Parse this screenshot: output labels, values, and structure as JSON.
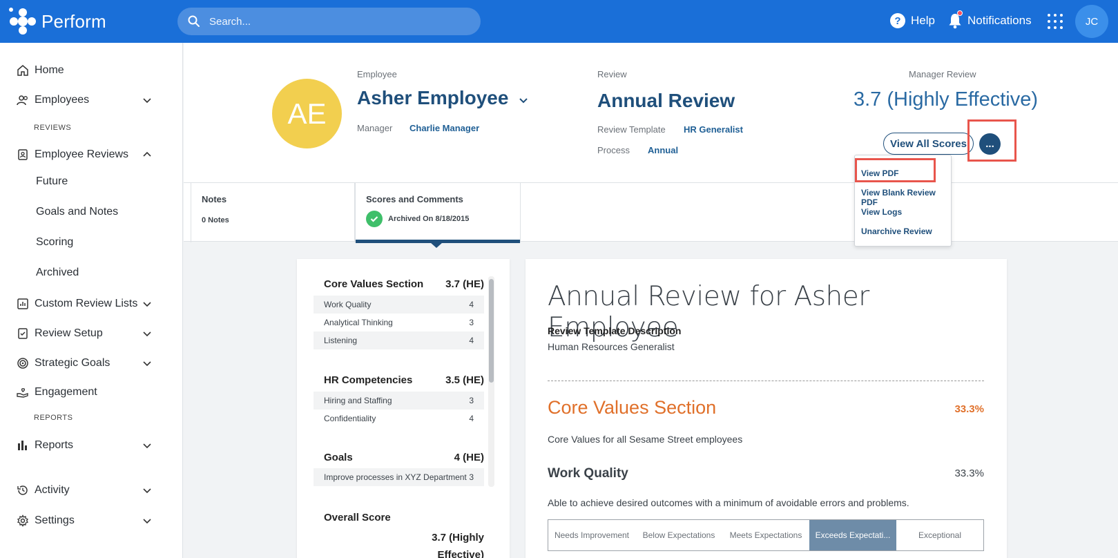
{
  "app": {
    "name": "Perform"
  },
  "search": {
    "placeholder": "Search..."
  },
  "topbar": {
    "help": "Help",
    "notifications": "Notifications",
    "user_initials": "JC"
  },
  "sidebar": {
    "home": "Home",
    "employees": "Employees",
    "reviews_section": "REVIEWS",
    "employee_reviews": "Employee Reviews",
    "sub_items": [
      "Future",
      "Goals and Notes",
      "Scoring",
      "Archived"
    ],
    "custom_review_lists": "Custom Review Lists",
    "review_setup": "Review Setup",
    "strategic_goals": "Strategic Goals",
    "engagement": "Engagement",
    "reports_section": "REPORTS",
    "reports": "Reports",
    "activity": "Activity",
    "settings": "Settings"
  },
  "header": {
    "avatar_initials": "AE",
    "employee_label": "Employee",
    "employee_name": "Asher Employee",
    "manager_label": "Manager",
    "manager_name": "Charlie Manager",
    "review_label": "Review",
    "review_name": "Annual Review",
    "template_label": "Review Template",
    "template_name": "HR Generalist",
    "process_label": "Process",
    "process_name": "Annual",
    "manager_review_label": "Manager Review",
    "manager_review_score": "3.7 (Highly Effective)",
    "view_all_scores": "View All Scores",
    "more_label": "..."
  },
  "menu": {
    "items": [
      "View PDF",
      "View Blank Review PDF",
      "View Logs",
      "Unarchive Review"
    ]
  },
  "tabs": [
    {
      "title": "Notes",
      "sub": "0 Notes"
    },
    {
      "title": "Scores and Comments",
      "sub": "Archived On 8/18/2015"
    }
  ],
  "score_panel": {
    "sections": [
      {
        "name": "Core Values Section",
        "score": "3.7 (HE)",
        "rows": [
          {
            "label": "Work Quality",
            "value": "4"
          },
          {
            "label": "Analytical Thinking",
            "value": "3"
          },
          {
            "label": "Listening",
            "value": "4"
          }
        ]
      },
      {
        "name": "HR Competencies",
        "score": "3.5 (HE)",
        "rows": [
          {
            "label": "Hiring and Staffing",
            "value": "3"
          },
          {
            "label": "Confidentiality",
            "value": "4"
          }
        ]
      },
      {
        "name": "Goals",
        "score": "4 (HE)",
        "rows": [
          {
            "label": "Improve processes in XYZ Department",
            "value": "3"
          }
        ]
      }
    ],
    "overall_label": "Overall Score",
    "overall_value_line1": "3.7 (Highly",
    "overall_value_line2": "Effective)"
  },
  "main": {
    "title": "Annual Review for Asher Employee",
    "template_desc_label": "Review Template Description",
    "template_desc_value": "Human Resources Generalist",
    "section_title": "Core Values Section",
    "section_pct": "33.3%",
    "section_desc": "Core Values for all Sesame Street employees",
    "item_title": "Work Quality",
    "item_pct": "33.3%",
    "item_desc": "Able to achieve desired outcomes with a minimum of avoidable errors and problems.",
    "rating_options": [
      "Needs Improvement",
      "Below Expectations",
      "Meets Expectations",
      "Exceeds Expectati...",
      "Exceptional"
    ],
    "rating_selected": 3
  },
  "colors": {
    "brand": "#1a6fd8",
    "navy": "#1f4f7b",
    "accent_orange": "#e0702a",
    "highlight": "#e8554c"
  }
}
